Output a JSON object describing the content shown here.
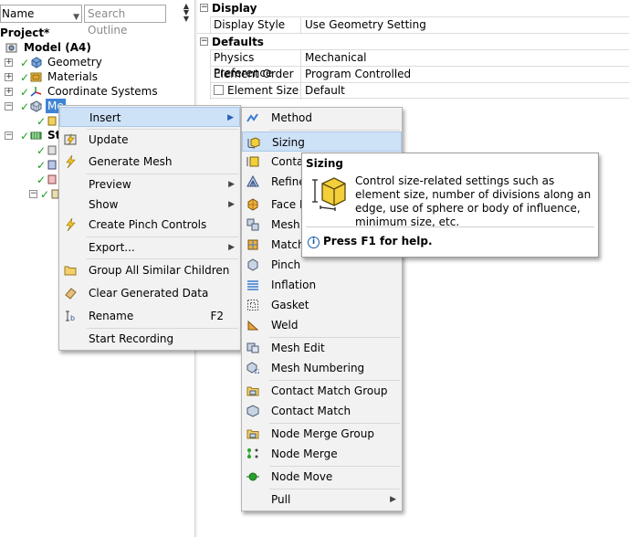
{
  "outline": {
    "name_field": "Name",
    "search_placeholder": "Search Outline",
    "project_label": "Project*",
    "model_label": "Model (A4)",
    "items": {
      "geometry": "Geometry",
      "materials": "Materials",
      "coordinate_systems": "Coordinate Systems",
      "mesh": "Me",
      "static": "St"
    }
  },
  "details": {
    "display": {
      "title": "Display",
      "display_style_key": "Display Style",
      "display_style_value": "Use Geometry Setting"
    },
    "defaults": {
      "title": "Defaults",
      "physics_key": "Physics Preference",
      "physics_value": "Mechanical",
      "order_key": "Element Order",
      "order_value": "Program Controlled",
      "size_key": "Element Size",
      "size_value": "Default"
    }
  },
  "context_menu": {
    "insert": "Insert",
    "update": "Update",
    "generate_mesh": "Generate Mesh",
    "preview": "Preview",
    "show": "Show",
    "create_pinch": "Create Pinch Controls",
    "export": "Export...",
    "group_all": "Group All Similar Children",
    "clear_data": "Clear Generated Data",
    "rename": "Rename",
    "rename_shortcut": "F2",
    "start_recording": "Start Recording"
  },
  "insert_submenu": {
    "method": "Method",
    "sizing": "Sizing",
    "contact": "Contact",
    "refine": "Refine",
    "face": "Face M",
    "mesh_copy": "Mesh",
    "match": "Match",
    "pinch": "Pinch",
    "inflation": "Inflation",
    "gasket": "Gasket",
    "weld": "Weld",
    "mesh_edit": "Mesh Edit",
    "mesh_numbering": "Mesh Numbering",
    "contact_match_group": "Contact Match Group",
    "contact_match": "Contact Match",
    "node_merge_group": "Node Merge Group",
    "node_merge": "Node Merge",
    "node_move": "Node Move",
    "pull": "Pull"
  },
  "tooltip": {
    "title": "Sizing",
    "body": "Control size-related settings such as element size, number of divisions along an edge, use of sphere or body of influence, minimum size, etc.",
    "help": "Press F1 for help."
  },
  "colors": {
    "menu_bg": "#f2f2f2",
    "highlight": "#cde1f7",
    "check_green": "#1c9d1c",
    "selection_blue": "#3f84d6"
  }
}
